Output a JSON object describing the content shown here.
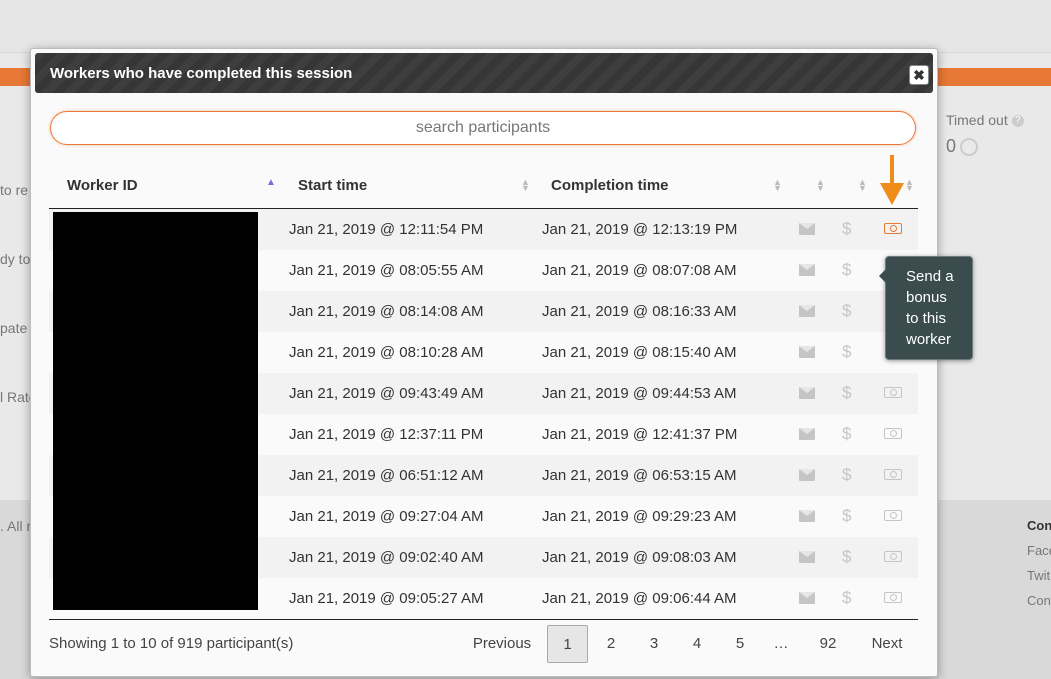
{
  "background": {
    "left_fragments": [
      "to re",
      "dy to",
      "pate",
      "l Rate",
      ". All r"
    ],
    "timed_out_label": "Timed out",
    "timed_out_value": "0",
    "footer_links": [
      "Con",
      "Face",
      "Twit",
      "Cont"
    ]
  },
  "modal": {
    "title": "Workers who have completed this session",
    "close_glyph": "✖",
    "search_placeholder": "search participants",
    "columns": {
      "worker_id": "Worker ID",
      "start_time": "Start time",
      "completion_time": "Completion time"
    },
    "rows": [
      {
        "start": "Jan 21, 2019 @ 12:11:54 PM",
        "completion": "Jan 21, 2019 @ 12:13:19 PM"
      },
      {
        "start": "Jan 21, 2019 @ 08:05:55 AM",
        "completion": "Jan 21, 2019 @ 08:07:08 AM"
      },
      {
        "start": "Jan 21, 2019 @ 08:14:08 AM",
        "completion": "Jan 21, 2019 @ 08:16:33 AM"
      },
      {
        "start": "Jan 21, 2019 @ 08:10:28 AM",
        "completion": "Jan 21, 2019 @ 08:15:40 AM"
      },
      {
        "start": "Jan 21, 2019 @ 09:43:49 AM",
        "completion": "Jan 21, 2019 @ 09:44:53 AM"
      },
      {
        "start": "Jan 21, 2019 @ 12:37:11 PM",
        "completion": "Jan 21, 2019 @ 12:41:37 PM"
      },
      {
        "start": "Jan 21, 2019 @ 06:51:12 AM",
        "completion": "Jan 21, 2019 @ 06:53:15 AM"
      },
      {
        "start": "Jan 21, 2019 @ 09:27:04 AM",
        "completion": "Jan 21, 2019 @ 09:29:23 AM"
      },
      {
        "start": "Jan 21, 2019 @ 09:02:40 AM",
        "completion": "Jan 21, 2019 @ 09:08:03 AM"
      },
      {
        "start": "Jan 21, 2019 @ 09:05:27 AM",
        "completion": "Jan 21, 2019 @ 09:06:44 AM"
      }
    ],
    "row_icons": [
      "envelope-icon",
      "dollar-icon",
      "bonus-money-icon"
    ],
    "tooltip": "Send a bonus to this worker",
    "showing_text": "Showing 1 to 10 of 919 participant(s)",
    "pagination": {
      "previous": "Previous",
      "pages": [
        "1",
        "2",
        "3",
        "4",
        "5",
        "…",
        "92"
      ],
      "current": "1",
      "next": "Next"
    }
  },
  "colors": {
    "accent": "#e87835",
    "arrow": "#f08c1a",
    "tooltip_bg": "#3b4c4f",
    "sort_active": "#7b6fd6"
  }
}
